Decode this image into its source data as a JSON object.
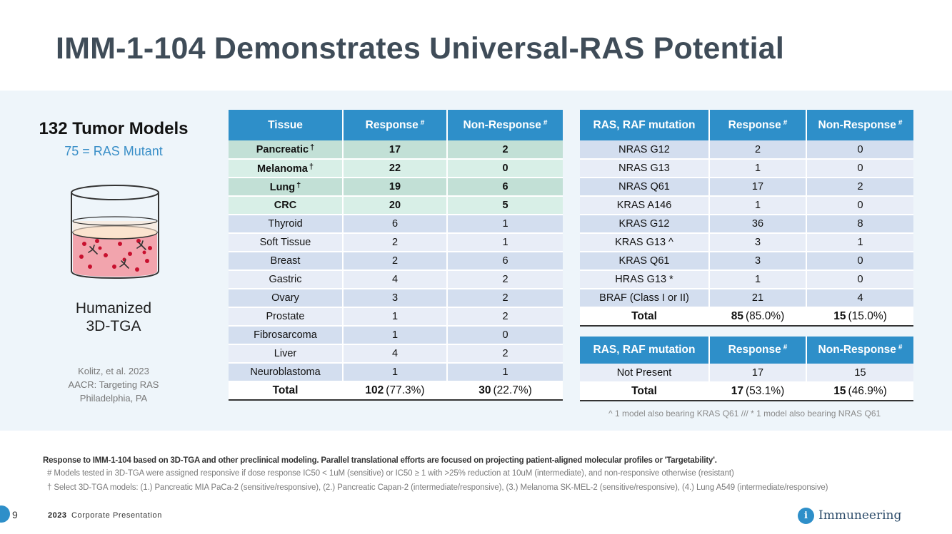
{
  "slide": {
    "title": "IMM-1-104 Demonstrates Universal-RAS Potential",
    "page_number": "9",
    "footer_year": "2023",
    "footer_label": "Corporate Presentation",
    "logo_text": "Immuneering",
    "logo_mark": "i",
    "accent_color": "#2e8fc9"
  },
  "left": {
    "title": "132 Tumor Models",
    "subtitle": "75 = RAS Mutant",
    "method_line1": "Humanized",
    "method_line2": "3D-TGA",
    "cite_line1": "Kolitz, et al. 2023",
    "cite_line2": "AACR: Targeting RAS",
    "cite_line3": "Philadelphia, PA",
    "icon": "beaker-with-cells-icon"
  },
  "tissue_table": {
    "headers": [
      "Tissue",
      "Response",
      "Non-Response"
    ],
    "header_mark": "#",
    "rows": [
      {
        "tissue": "Pancreatic",
        "mark": "†",
        "response": "17",
        "nonresponse": "2"
      },
      {
        "tissue": "Melanoma",
        "mark": "†",
        "response": "22",
        "nonresponse": "0"
      },
      {
        "tissue": "Lung",
        "mark": "†",
        "response": "19",
        "nonresponse": "6"
      },
      {
        "tissue": "CRC",
        "mark": "",
        "response": "20",
        "nonresponse": "5"
      },
      {
        "tissue": "Thyroid",
        "mark": "",
        "response": "6",
        "nonresponse": "1"
      },
      {
        "tissue": "Soft Tissue",
        "mark": "",
        "response": "2",
        "nonresponse": "1"
      },
      {
        "tissue": "Breast",
        "mark": "",
        "response": "2",
        "nonresponse": "6"
      },
      {
        "tissue": "Gastric",
        "mark": "",
        "response": "4",
        "nonresponse": "2"
      },
      {
        "tissue": "Ovary",
        "mark": "",
        "response": "3",
        "nonresponse": "2"
      },
      {
        "tissue": "Prostate",
        "mark": "",
        "response": "1",
        "nonresponse": "2"
      },
      {
        "tissue": "Fibrosarcoma",
        "mark": "",
        "response": "1",
        "nonresponse": "0"
      },
      {
        "tissue": "Liver",
        "mark": "",
        "response": "4",
        "nonresponse": "2"
      },
      {
        "tissue": "Neuroblastoma",
        "mark": "",
        "response": "1",
        "nonresponse": "1"
      }
    ],
    "total": {
      "label": "Total",
      "response": "102",
      "response_pct": "(77.3%)",
      "nonresponse": "30",
      "nonresponse_pct": "(22.7%)"
    }
  },
  "mutation_table": {
    "headers": [
      "RAS, RAF mutation",
      "Response",
      "Non-Response"
    ],
    "header_mark": "#",
    "rows": [
      {
        "mutation": "NRAS G12",
        "response": "2",
        "nonresponse": "0"
      },
      {
        "mutation": "NRAS G13",
        "response": "1",
        "nonresponse": "0"
      },
      {
        "mutation": "NRAS Q61",
        "response": "17",
        "nonresponse": "2"
      },
      {
        "mutation": "KRAS A146",
        "response": "1",
        "nonresponse": "0"
      },
      {
        "mutation": "KRAS G12",
        "response": "36",
        "nonresponse": "8"
      },
      {
        "mutation": "KRAS G13 ^",
        "response": "3",
        "nonresponse": "1"
      },
      {
        "mutation": "KRAS Q61",
        "response": "3",
        "nonresponse": "0"
      },
      {
        "mutation": "HRAS G13 *",
        "response": "1",
        "nonresponse": "0"
      },
      {
        "mutation": "BRAF (Class I or II)",
        "response": "21",
        "nonresponse": "4"
      }
    ],
    "total": {
      "label": "Total",
      "response": "85",
      "response_pct": "(85.0%)",
      "nonresponse": "15",
      "nonresponse_pct": "(15.0%)"
    }
  },
  "absent_table": {
    "headers": [
      "RAS, RAF mutation",
      "Response",
      "Non-Response"
    ],
    "header_mark": "#",
    "rows": [
      {
        "mutation": "Not Present",
        "response": "17",
        "nonresponse": "15"
      }
    ],
    "total": {
      "label": "Total",
      "response": "17",
      "response_pct": "(53.1%)",
      "nonresponse": "15",
      "nonresponse_pct": "(46.9%)"
    }
  },
  "footnotes": {
    "right_tables": "^ 1 model also bearing KRAS Q61 /// * 1 model also bearing NRAS Q61",
    "main": "Response to IMM-1-104 based on 3D-TGA and other preclinical modeling. Parallel translational efforts are focused on projecting patient-aligned molecular profiles or 'Targetability'.",
    "hash_note": "# Models tested in 3D-TGA were assigned responsive if dose response IC50 < 1uM (sensitive) or IC50 ≥ 1 with >25% reduction at 10uM (intermediate), and non-responsive otherwise (resistant)",
    "dagger_note": "† Select 3D-TGA models: (1.) Pancreatic MIA PaCa-2 (sensitive/responsive), (2.) Pancreatic Capan-2 (intermediate/responsive), (3.) Melanoma SK-MEL-2 (sensitive/responsive), (4.) Lung A549 (intermediate/responsive)"
  }
}
